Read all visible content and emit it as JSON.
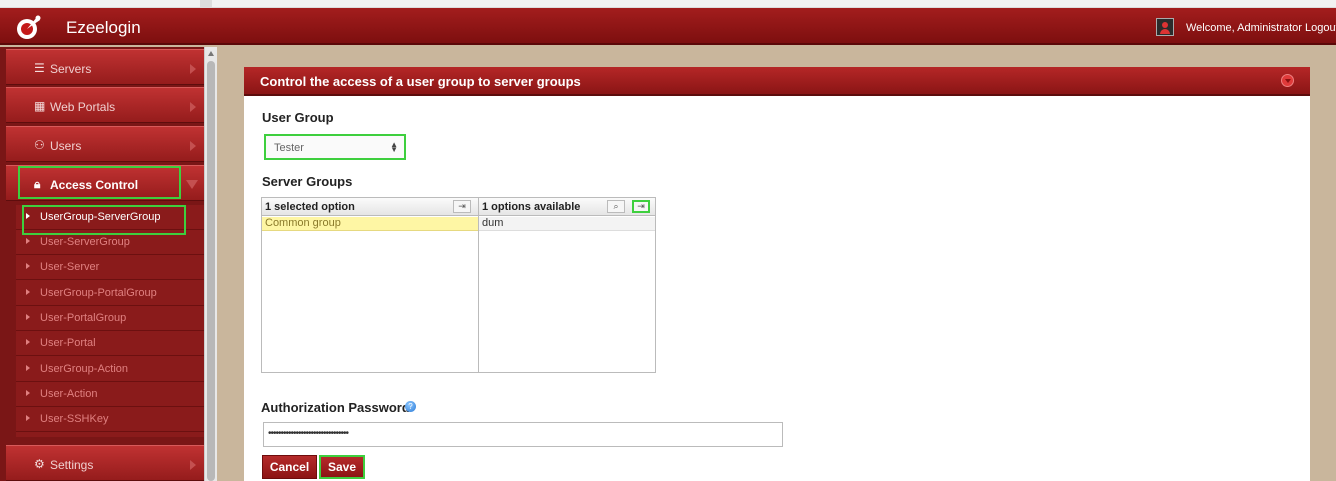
{
  "app": {
    "title": "Ezeelogin",
    "welcome": "Welcome, Administrator Logout"
  },
  "sidebar": {
    "items": [
      {
        "label": "Servers",
        "icon": "list-icon"
      },
      {
        "label": "Web Portals",
        "icon": "web-portal-icon"
      },
      {
        "label": "Users",
        "icon": "users-icon"
      },
      {
        "label": "Access Control",
        "icon": "lock-icon"
      },
      {
        "label": "Settings",
        "icon": "gears-icon"
      }
    ],
    "submenu": [
      "UserGroup-ServerGroup",
      "User-ServerGroup",
      "User-Server",
      "UserGroup-PortalGroup",
      "User-PortalGroup",
      "User-Portal",
      "UserGroup-Action",
      "User-Action",
      "User-SSHKey"
    ]
  },
  "panel": {
    "title": "Control the access of a user group to server groups",
    "user_group_label": "User Group",
    "user_group_value": "Tester",
    "server_groups_label": "Server Groups",
    "selected_header": "1 selected option",
    "available_header": "1 options available",
    "selected_items": [
      "Common group"
    ],
    "available_items": [
      "dum"
    ],
    "password_label": "Authorization Password",
    "password_value": "••••••••••••••••••••••••••••••••",
    "cancel_label": "Cancel",
    "save_label": "Save"
  },
  "colors": {
    "accent_red": "#a31d1d",
    "highlight_green": "#3ecf3e",
    "selected_yellow": "#fef6a4"
  }
}
